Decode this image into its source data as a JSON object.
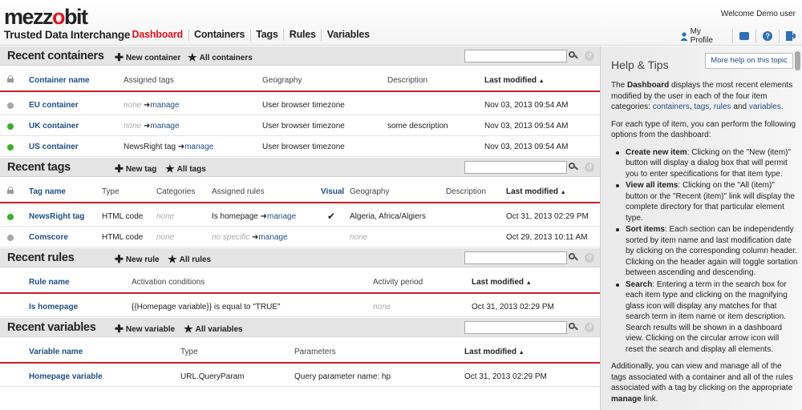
{
  "header": {
    "logo_a": "mezz",
    "logo_o": "o",
    "logo_b": "bit",
    "tagline": "Trusted Data Interchange",
    "nav": [
      "Dashboard",
      "Containers",
      "Tags",
      "Rules",
      "Variables"
    ],
    "welcome": "Welcome Demo user",
    "my_profile": "My Profile",
    "help_glyph": "?",
    "icons": [
      "user-icon",
      "mail-icon",
      "help-icon",
      "logout-icon"
    ],
    "accent": "#e2131f"
  },
  "containers": {
    "title": "Recent containers",
    "new_label": "New container",
    "all_label": "All containers",
    "cols": [
      "Container name",
      "Assigned tags",
      "Geography",
      "Description",
      "Last modified"
    ],
    "rows": [
      {
        "name": "EU container",
        "tags": "none",
        "manage": "manage",
        "geo": "User browser timezone",
        "desc": "",
        "mod": "Nov 03, 2013 09:54 AM",
        "status": "grey"
      },
      {
        "name": "UK container",
        "tags": "none",
        "manage": "manage",
        "geo": "User browser timezone",
        "desc": "some description",
        "mod": "Nov 03, 2013 09:54 AM",
        "status": "green"
      },
      {
        "name": "US container",
        "tags": "NewsRight tag",
        "manage": "manage",
        "geo": "User browser timezone",
        "desc": "",
        "mod": "Nov 03, 2013 09:54 AM",
        "status": "green"
      }
    ]
  },
  "tags": {
    "title": "Recent tags",
    "new_label": "New tag",
    "all_label": "All tags",
    "cols": [
      "Tag name",
      "Type",
      "Categories",
      "Assigned rules",
      "Visual",
      "Geography",
      "Description",
      "Last modified"
    ],
    "rows": [
      {
        "name": "NewsRight tag",
        "type": "HTML code",
        "cat": "none",
        "rules": "Is homepage",
        "manage": "manage",
        "visual": "✔",
        "geo": "Algeria, Africa/Algiers",
        "desc": "",
        "mod": "Oct 31, 2013 02:29 PM",
        "status": "green"
      },
      {
        "name": "Comscore",
        "type": "HTML code",
        "cat": "none",
        "rules": "no specific",
        "manage": "manage",
        "visual": "",
        "geo": "none",
        "desc": "",
        "mod": "Oct 29, 2013 10:11 AM",
        "status": "grey"
      }
    ]
  },
  "rules": {
    "title": "Recent rules",
    "new_label": "New rule",
    "all_label": "All rules",
    "cols": [
      "Rule name",
      "Activation conditions",
      "Activity period",
      "Last modified"
    ],
    "rows": [
      {
        "name": "Is homepage",
        "cond": "{{Homepage variable}} is equal to \"TRUE\"",
        "period": "none",
        "mod": "Oct 31, 2013 02:29 PM"
      }
    ]
  },
  "variables": {
    "title": "Recent variables",
    "new_label": "New variable",
    "all_label": "All variables",
    "cols": [
      "Variable name",
      "Type",
      "Parameters",
      "Last modified"
    ],
    "rows": [
      {
        "name": "Homepage variable",
        "type": "URL.QueryParam",
        "params": "Query parameter name: hp",
        "mod": "Oct 31, 2013 02:29 PM"
      }
    ]
  },
  "glyphs": {
    "plus": "✚",
    "star": "★",
    "arrow": "➜",
    "sort": "▲",
    "reset": "↺"
  },
  "help": {
    "title": "Help & Tips",
    "more": "More help on this topic",
    "p1_a": "The ",
    "p1_b": "Dashboard",
    "p1_c": " displays the most recent elements modified by the user in each of the four item categories: ",
    "p1_l1": "containers",
    "p1_l2": "tags",
    "p1_l3": "rules",
    "p1_l4": "variables",
    "comma": ", ",
    "and": " and ",
    "period": ".",
    "p2": "For each type of item, you can perform the following options from the dashboard:",
    "items": [
      {
        "b": "Create new item",
        "t": ": Clicking on the \"New (item)\" button will display a dialog box that will permit you to enter specifications for that item type."
      },
      {
        "b": "View all items",
        "t": ": Clicking on the \"All (item)\" button or the \"Recent (item)\" link will display the complete directory for that particular element type."
      },
      {
        "b": "Sort items",
        "t": ": Each section can be independently sorted by item name and last modification date by clicking on the corresponding column header. Clicking on the header again will toggle sortation between ascending and descending."
      },
      {
        "b": "Search",
        "t": ": Entering a term in the search box for each item type and clicking on the magnifying glass icon will display any matches for that search term in item name or item description. Search results will be shown in a dashboard view. Clicking on the circular arrow icon will reset the search and display all elements."
      }
    ],
    "p3_a": "Additionally, you can view and manage all of the tags associated with a container and all of the rules associated with a tag by clicking on the appropriate ",
    "p3_b": "manage",
    "p3_c": " link."
  }
}
